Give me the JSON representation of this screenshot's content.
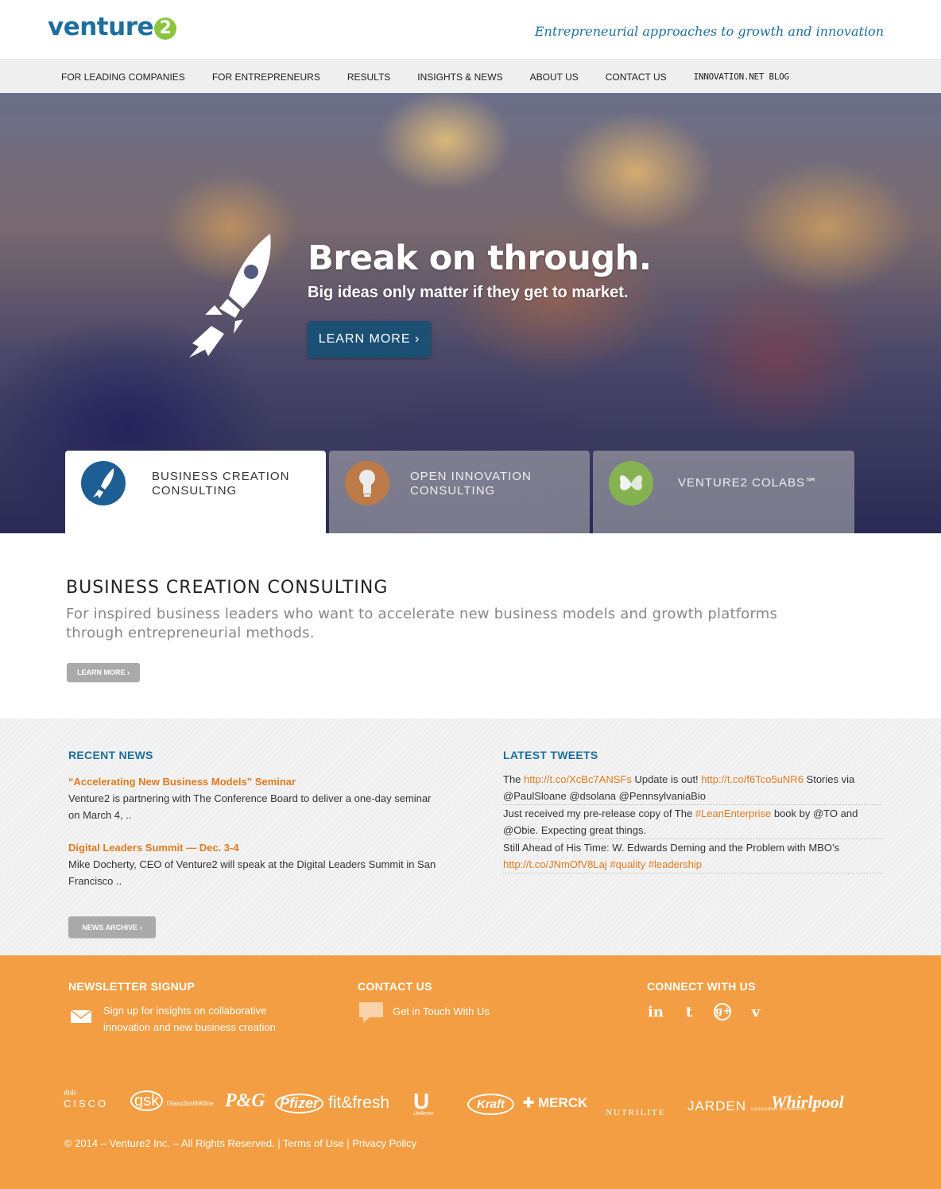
{
  "header": {
    "logo_text": "venture",
    "logo_badge": "2",
    "tagline": "Entrepreneurial approaches to growth and innovation"
  },
  "nav": {
    "items": [
      "FOR LEADING COMPANIES",
      "FOR ENTREPRENEURS",
      "RESULTS",
      "INSIGHTS & NEWS",
      "ABOUT US",
      "CONTACT US",
      "INNOVATION.NET BLOG"
    ]
  },
  "hero": {
    "title": "Break on through.",
    "subtitle": "Big ideas only matter if they get to market.",
    "button": "LEARN MORE  ›",
    "tabs": [
      {
        "label": "BUSINESS CREATION\nCONSULTING",
        "icon": "rocket-icon",
        "color": "#1d5f94"
      },
      {
        "label": "OPEN INNOVATION\nCONSULTING",
        "icon": "lightbulb-icon",
        "color": "#c87b3c"
      },
      {
        "label": "VENTURE2 COLABS℠",
        "icon": "butterfly-icon",
        "color": "#86b94b"
      }
    ]
  },
  "section": {
    "title": "BUSINESS CREATION CONSULTING",
    "description": "For inspired business leaders who want to accelerate new business models and growth platforms through entrepreneurial methods.",
    "button": "LEARN MORE ›"
  },
  "news": {
    "title": "RECENT NEWS",
    "items": [
      {
        "title": "“Accelerating New Business Models” Seminar",
        "body": "Venture2 is partnering with The Conference Board to deliver a one-day seminar on March 4, .."
      },
      {
        "title": "Digital Leaders Summit — Dec. 3-4",
        "body": "Mike Docherty, CEO of Venture2 will speak at the Digital Leaders Summit in San Francisco .."
      }
    ],
    "archive_button": "NEWS ARCHIVE ›"
  },
  "tweets": {
    "title": "LATEST TWEETS",
    "t1_a": "The ",
    "t1_link1": "http://t.co/XcBc7ANSFs",
    "t1_b": " Update is out! ",
    "t1_link2": "http://t.co/f6Tco5uNR6",
    "t1_c": " Stories via @PaulSloane @dsolana @PennsylvaniaBio",
    "t2_a": "Just received my pre-release copy of The ",
    "t2_link": "#LeanEnterprise",
    "t2_b": " book by @TO and @Obie. Expecting great things.",
    "t3_a": "Still Ahead of His Time: W. Edwards Deming and the Problem with MBO’s ",
    "t3_link": "http://t.co/JNmOfV8Laj #quality #leadership"
  },
  "footer": {
    "newsletter_title": "NEWSLETTER SIGNUP",
    "newsletter_text": "Sign up for insights on collaborative innovation and new business creation",
    "contact_title": "CONTACT US",
    "contact_text": "Get in Touch With Us",
    "connect_title": "CONNECT WITH US",
    "social": [
      "in",
      "t",
      "g+",
      "v"
    ],
    "client_logos": [
      "CISCO",
      "gsk",
      "GlaxoSmithKline",
      "P&G",
      "Pfizer",
      "fit&fresh",
      "Unilever",
      "Kraft",
      "MERCK",
      "NUTRILITE",
      "JARDEN",
      "consumer solutions",
      "Whirlpool"
    ],
    "copyright": "© 2014 – Venture2 Inc. – All Rights Reserved. | Terms of Use | Privacy Policy"
  },
  "colors": {
    "brand_blue": "#1d6fa0",
    "accent_orange": "#e07a1f",
    "footer_orange": "#f49e43",
    "green": "#8cc63f"
  }
}
